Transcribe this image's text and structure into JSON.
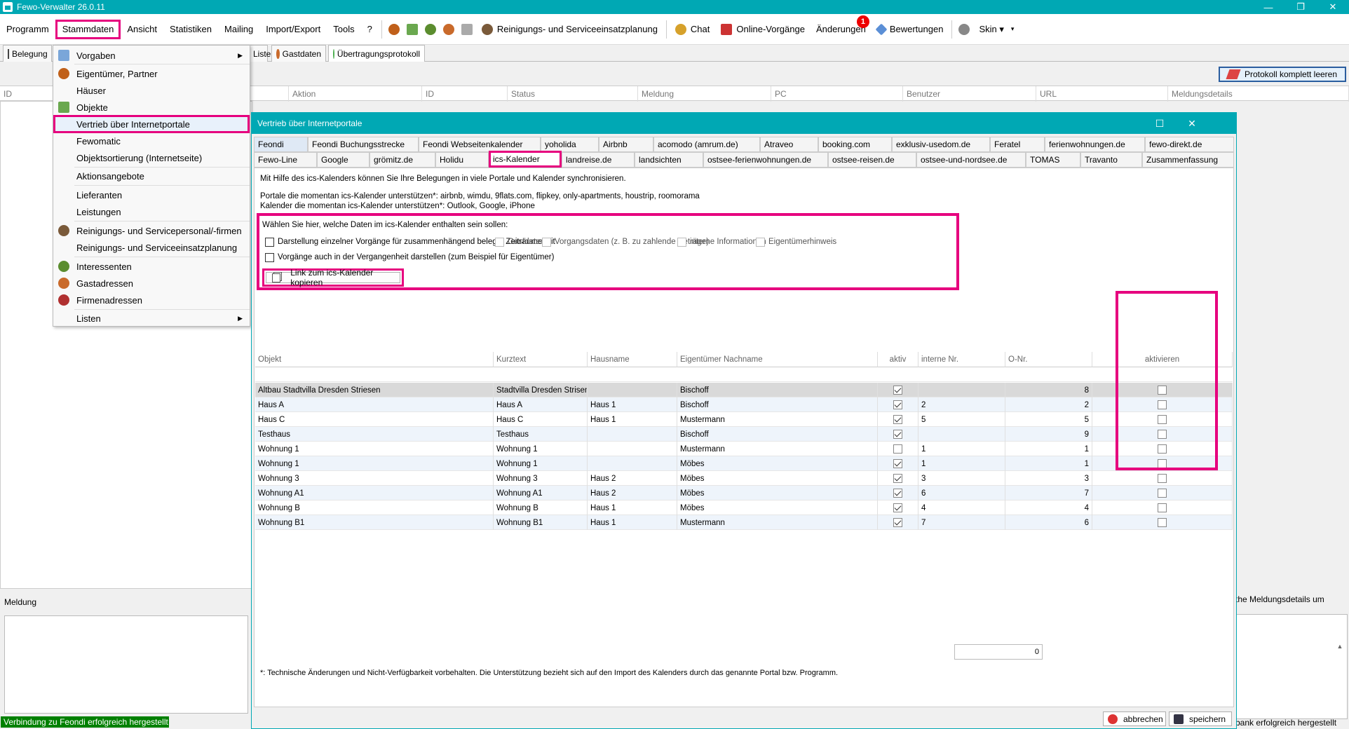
{
  "window": {
    "title": "Fewo-Verwalter 26.0.11",
    "minimize": "—",
    "maximize": "❐",
    "close": "✕"
  },
  "menu": {
    "items": [
      "Programm",
      "Stammdaten",
      "Ansicht",
      "Statistiken",
      "Mailing",
      "Import/Export",
      "Tools",
      "?"
    ],
    "reinigung": "Reinigungs- und Serviceeinsatzplanung",
    "chat": "Chat",
    "online": "Online-Vorgänge",
    "aenderungen": "Änderungen",
    "aenderungen_badge": "1",
    "bewertungen": "Bewertungen",
    "skin": "Skin ▾",
    "skin_arrow": "▾"
  },
  "main_tabs": {
    "belegung": "Belegung",
    "liste": "Liste",
    "gastdaten": "Gastdaten",
    "protokoll": "Übertragungsprotokoll"
  },
  "toolbar": {
    "protokoll_leeren": "Protokoll komplett leeren"
  },
  "grid_headers": [
    "ID",
    "Aktion",
    "ID",
    "Status",
    "Meldung",
    "PC",
    "Benutzer",
    "URL",
    "Meldungsdetails"
  ],
  "dropdown": {
    "items": [
      {
        "label": "Vorgaben",
        "sub": true
      },
      {
        "label": "Eigentümer, Partner"
      },
      {
        "label": "Häuser"
      },
      {
        "label": "Objekte"
      },
      {
        "label": "Vertrieb über Internetportale",
        "highlight": true
      },
      {
        "label": "Fewomatic"
      },
      {
        "label": "Objektsortierung (Internetseite)"
      },
      {
        "label": "Aktionsangebote"
      },
      {
        "label": "Lieferanten"
      },
      {
        "label": "Leistungen"
      },
      {
        "label": "Reinigungs- und Servicepersonal/-firmen"
      },
      {
        "label": "Reinigungs- und Serviceeinsatzplanung"
      },
      {
        "label": "Interessenten"
      },
      {
        "label": "Gastadressen"
      },
      {
        "label": "Firmenadressen"
      },
      {
        "label": "Listen",
        "sub": true
      }
    ]
  },
  "left": {
    "meldung": "Meldung",
    "status": "Verbindung zu Feondi erfolgreich hergestellt"
  },
  "right": {
    "text": "the Meldungsdetails um",
    "status": "bank erfolgreich hergestellt"
  },
  "dialog": {
    "title": "Vertrieb über Internetportale",
    "tabs_row1": [
      "Feondi",
      "Feondi Buchungsstrecke",
      "Feondi Webseitenkalender",
      "yoholida",
      "Airbnb",
      "acomodo (amrum.de)",
      "Atraveo",
      "booking.com",
      "exklusiv-usedom.de",
      "Feratel",
      "ferienwohnungen.de",
      "fewo-direkt.de"
    ],
    "tabs_row2": [
      "Fewo-Line",
      "Google",
      "grömitz.de",
      "Holidu",
      "ics-Kalender",
      "landreise.de",
      "landsichten",
      "ostsee-ferienwohnungen.de",
      "ostsee-reisen.de",
      "ostsee-und-nordsee.de",
      "TOMAS",
      "Travanto",
      "Zusammenfassung"
    ],
    "desc1": "Mit Hilfe des ics-Kalenders können Sie Ihre Belegungen in viele Portale und Kalender synchronisieren.",
    "desc2": "Portale die momentan ics-Kalender unterstützen*: airbnb, wimdu, 9flats.com, flipkey, only-apartments, houstrip, roomorama",
    "desc3": "Kalender die momentan ics-Kalender unterstützen*: Outlook, Google, iPhone",
    "opt_title": "Wählen Sie hier, welche Daten im ics-Kalender enthalten sein sollen:",
    "opt1": "Darstellung einzelner Vorgänge für zusammenhängend belegte Zeiträume mit",
    "opt_gast": "Gastdaten",
    "opt_vorgang": "Vorgangsdaten (z. B. zu zahlende Beträge)",
    "opt_intern": "interne Informationen",
    "opt_eigent": "Eigentümerhinweis",
    "opt2": "Vorgänge auch in der Vergangenheit darstellen (zum Beispiel für Eigentümer)",
    "link_btn": "Link zum ics-Kalender kopieren",
    "table_headers": [
      "Objekt",
      "Kurztext",
      "Hausname",
      "Eigentümer Nachname",
      "aktiv",
      "interne Nr.",
      "O-Nr.",
      "aktivieren"
    ],
    "rows": [
      {
        "objekt": "Altbau Stadtvilla Dresden Striesen",
        "kurz": "Stadtvilla Dresden Strisen",
        "haus": "",
        "eig": "Bischoff",
        "aktiv": true,
        "intern": "",
        "onr": "8"
      },
      {
        "objekt": "Haus A",
        "kurz": "Haus A",
        "haus": "Haus 1",
        "eig": "Bischoff",
        "aktiv": true,
        "intern": "2",
        "onr": "2"
      },
      {
        "objekt": "Haus C",
        "kurz": "Haus C",
        "haus": "Haus 1",
        "eig": "Mustermann",
        "aktiv": true,
        "intern": "5",
        "onr": "5"
      },
      {
        "objekt": "Testhaus",
        "kurz": "Testhaus",
        "haus": "",
        "eig": "Bischoff",
        "aktiv": true,
        "intern": "",
        "onr": "9"
      },
      {
        "objekt": "Wohnung 1",
        "kurz": "Wohnung 1",
        "haus": "",
        "eig": "Mustermann",
        "aktiv": false,
        "intern": "1",
        "onr": "1"
      },
      {
        "objekt": "Wohnung 1",
        "kurz": "Wohnung 1",
        "haus": "",
        "eig": "Möbes",
        "aktiv": true,
        "intern": "1",
        "onr": "1"
      },
      {
        "objekt": "Wohnung 3",
        "kurz": "Wohnung 3",
        "haus": "Haus 2",
        "eig": "Möbes",
        "aktiv": true,
        "intern": "3",
        "onr": "3"
      },
      {
        "objekt": "Wohnung A1",
        "kurz": "Wohnung A1",
        "haus": "Haus 2",
        "eig": "Möbes",
        "aktiv": true,
        "intern": "6",
        "onr": "7"
      },
      {
        "objekt": "Wohnung B",
        "kurz": "Wohnung B",
        "haus": "Haus 1",
        "eig": "Möbes",
        "aktiv": true,
        "intern": "4",
        "onr": "4"
      },
      {
        "objekt": "Wohnung B1",
        "kurz": "Wohnung B1",
        "haus": "Haus 1",
        "eig": "Mustermann",
        "aktiv": true,
        "intern": "7",
        "onr": "6"
      }
    ],
    "sum_value": "0",
    "footnote": "*: Technische Änderungen und Nicht-Verfügbarkeit vorbehalten. Die Unterstützung bezieht sich auf den Import des Kalenders durch das genannte Portal bzw. Programm.",
    "cancel": "abbrechen",
    "save": "speichern"
  },
  "colors": {
    "accent": "#00a8b4",
    "highlight": "#e6007e",
    "status_ok": "#008000"
  }
}
